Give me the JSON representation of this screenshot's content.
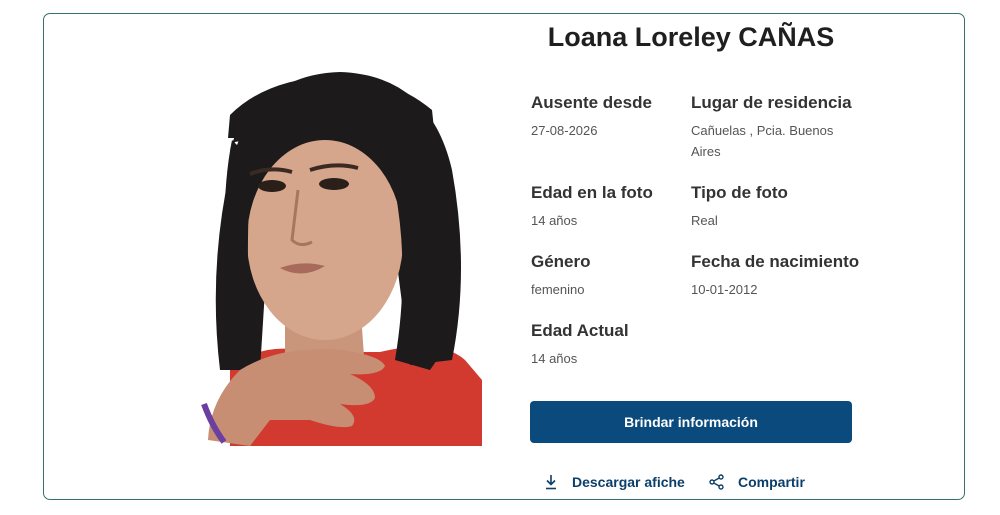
{
  "person": {
    "name": "Loana Loreley CAÑAS"
  },
  "fields": {
    "ausente_desde": {
      "label": "Ausente desde",
      "value": "27-08-2026"
    },
    "lugar_residencia": {
      "label": "Lugar de residencia",
      "value": "Cañuelas , Pcia. Buenos Aires"
    },
    "edad_foto": {
      "label": "Edad en la foto",
      "value": "14 años"
    },
    "tipo_foto": {
      "label": "Tipo de foto",
      "value": "Real"
    },
    "genero": {
      "label": "Género",
      "value": "femenino"
    },
    "fecha_nacimiento": {
      "label": "Fecha de nacimiento",
      "value": "10-01-2012"
    },
    "edad_actual": {
      "label": "Edad Actual",
      "value": "14 años"
    }
  },
  "actions": {
    "brindar_label": "Brindar información",
    "descargar_label": "Descargar afiche",
    "compartir_label": "Compartir"
  },
  "icons": {
    "download": "download-icon",
    "share": "share-icon"
  },
  "colors": {
    "card_border": "#3a6f6a",
    "primary_button": "#0b4a7c",
    "link": "#0b3f6a"
  }
}
